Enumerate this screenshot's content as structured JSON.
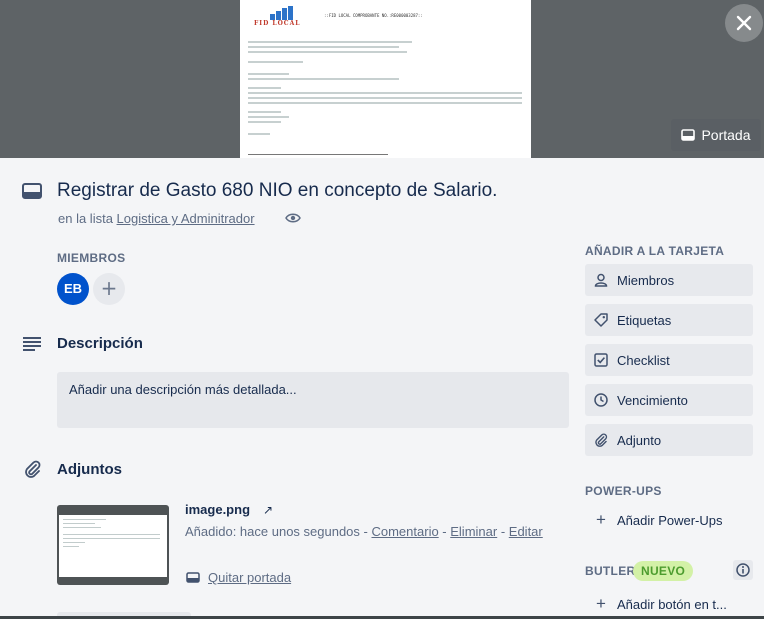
{
  "cover": {
    "doc_brand": "FID LOCAL",
    "doc_header": "::FID LOCAL COMPROBANTE NO.:RE000003287::",
    "portada_label": "Portada"
  },
  "card": {
    "title": "Registrar de Gasto 680 NIO en concepto de Salario.",
    "list_prefix": "en la lista",
    "list_name": "Logistica y Adminitrador"
  },
  "members": {
    "label": "MIEMBROS",
    "avatar_initials": "EB",
    "add_symbol": "+"
  },
  "description": {
    "title": "Descripción",
    "placeholder": "Añadir una descripción más detallada..."
  },
  "attachments": {
    "title": "Adjuntos",
    "file_name": "image.png",
    "added_text": "Añadido: hace unos segundos",
    "comment_link": "Comentario",
    "delete_link": "Eliminar",
    "edit_link": "Editar",
    "remove_cover": "Quitar portada"
  },
  "sidebar": {
    "add_to_card_label": "AÑADIR A LA TARJETA",
    "buttons": [
      {
        "label": "Miembros",
        "icon": "person-icon"
      },
      {
        "label": "Etiquetas",
        "icon": "tag-icon"
      },
      {
        "label": "Checklist",
        "icon": "checkbox-icon"
      },
      {
        "label": "Vencimiento",
        "icon": "clock-icon"
      },
      {
        "label": "Adjunto",
        "icon": "paperclip-icon"
      }
    ],
    "powerups_label": "POWER-UPS",
    "add_powerups": "Añadir Power-Ups",
    "butler_label": "BUTLER",
    "new_badge": "NUEVO",
    "add_button": "Añadir botón en t..."
  },
  "colors": {
    "avatar": "#0052cc",
    "badge_bg": "#d3f1a7",
    "badge_text": "#4c9c2e",
    "panel_bg": "#f4f5f7"
  }
}
